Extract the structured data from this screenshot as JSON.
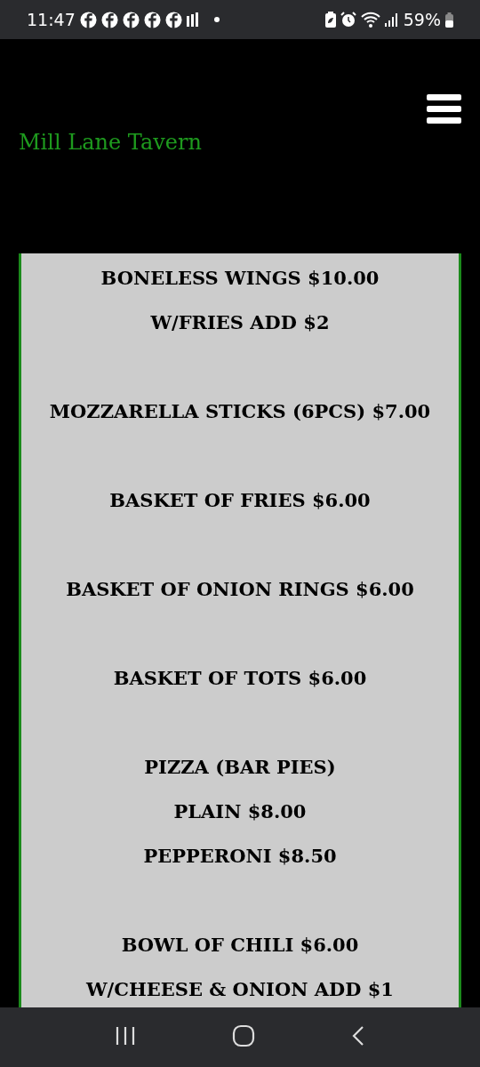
{
  "status_bar": {
    "time": "11:47",
    "notifications": [
      {
        "kind": "facebook"
      },
      {
        "kind": "facebook"
      },
      {
        "kind": "facebook"
      },
      {
        "kind": "facebook"
      },
      {
        "kind": "facebook"
      },
      {
        "kind": "bars"
      }
    ],
    "battery": "59%"
  },
  "header": {
    "title": "Mill Lane Tavern"
  },
  "menu_groups": [
    {
      "lines": [
        "BONELESS WINGS $10.00",
        "W/FRIES ADD $2"
      ]
    },
    {
      "lines": [
        "MOZZARELLA STICKS (6PCS) $7.00"
      ]
    },
    {
      "lines": [
        "BASKET OF FRIES $6.00"
      ]
    },
    {
      "lines": [
        "BASKET OF ONION RINGS $6.00"
      ]
    },
    {
      "lines": [
        "BASKET OF TOTS $6.00"
      ]
    },
    {
      "lines": [
        "PIZZA (BAR PIES)",
        "PLAIN $8.00",
        "PEPPERONI $8.50"
      ]
    },
    {
      "lines": [
        "BOWL OF CHILI $6.00",
        "W/CHEESE & ONION ADD $1"
      ]
    }
  ]
}
